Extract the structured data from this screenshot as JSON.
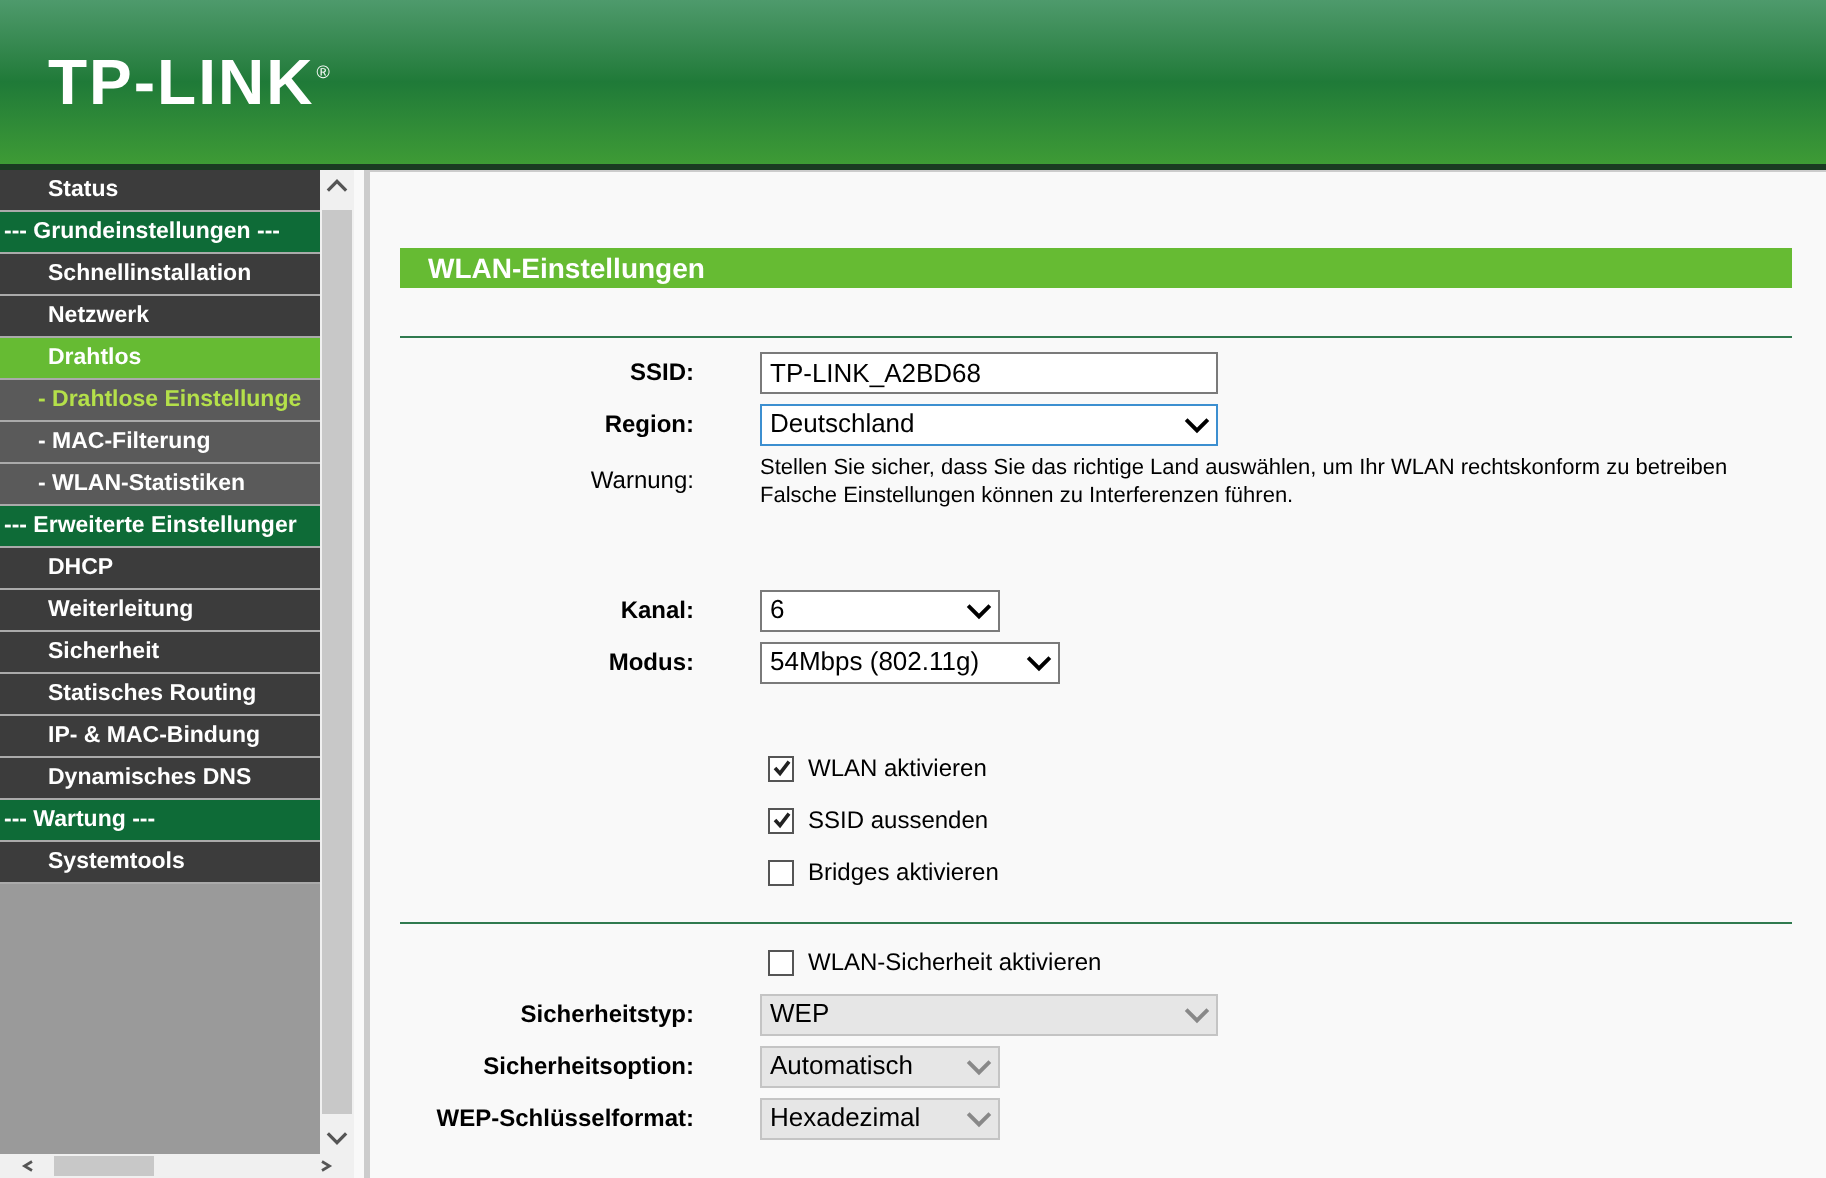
{
  "header": {
    "logo": "TP-LINK",
    "logo_mark": "®"
  },
  "menu": [
    {
      "kind": "item",
      "label": "Status",
      "selected": false
    },
    {
      "kind": "header",
      "label": "--- Grundeinstellungen ---"
    },
    {
      "kind": "item",
      "label": "Schnellinstallation",
      "selected": false
    },
    {
      "kind": "item",
      "label": "Netzwerk",
      "selected": false
    },
    {
      "kind": "item",
      "label": "Drahtlos",
      "selected": true
    },
    {
      "kind": "sub",
      "label": "- Drahtlose Einstellunge",
      "selected": true
    },
    {
      "kind": "sub",
      "label": "- MAC-Filterung",
      "selected": false
    },
    {
      "kind": "sub",
      "label": "- WLAN-Statistiken",
      "selected": false
    },
    {
      "kind": "header",
      "label": "--- Erweiterte Einstellunger"
    },
    {
      "kind": "item",
      "label": "DHCP",
      "selected": false
    },
    {
      "kind": "item",
      "label": "Weiterleitung",
      "selected": false
    },
    {
      "kind": "item",
      "label": "Sicherheit",
      "selected": false
    },
    {
      "kind": "item",
      "label": "Statisches Routing",
      "selected": false
    },
    {
      "kind": "item",
      "label": "IP- & MAC-Bindung",
      "selected": false
    },
    {
      "kind": "item",
      "label": "Dynamisches DNS",
      "selected": false
    },
    {
      "kind": "header",
      "label": "--- Wartung ---"
    },
    {
      "kind": "item",
      "label": "Systemtools",
      "selected": false
    }
  ],
  "page": {
    "title": "WLAN-Einstellungen",
    "section1": [
      {
        "kind": "text",
        "label": "SSID:",
        "value": "TP-LINK_A2BD68"
      },
      {
        "kind": "select",
        "label": "Region:",
        "value": "Deutschland",
        "focused": true,
        "disabled": false
      },
      {
        "kind": "note",
        "label": "Warnung:",
        "lines": [
          "Stellen Sie sicher, dass Sie das richtige Land auswählen, um Ihr WLAN rechtskonform zu betreiben",
          "Falsche Einstellungen können zu Interferenzen führen."
        ]
      },
      {
        "kind": "gap"
      },
      {
        "kind": "select",
        "label": "Kanal:",
        "value": "6",
        "focused": false,
        "disabled": false
      },
      {
        "kind": "select",
        "label": "Modus:",
        "value": "54Mbps (802.11g)",
        "focused": false,
        "disabled": false
      },
      {
        "kind": "gap"
      },
      {
        "kind": "checkbox",
        "label": "WLAN aktivieren",
        "checked": true
      },
      {
        "kind": "checkbox",
        "label": "SSID aussenden",
        "checked": true
      },
      {
        "kind": "checkbox",
        "label": "Bridges aktivieren",
        "checked": false
      }
    ],
    "section2": [
      {
        "kind": "checkbox",
        "label": "WLAN-Sicherheit aktivieren",
        "checked": false
      },
      {
        "kind": "select",
        "label": "Sicherheitstyp:",
        "value": "WEP",
        "focused": false,
        "disabled": true
      },
      {
        "kind": "select",
        "label": "Sicherheitsoption:",
        "value": "Automatisch",
        "focused": false,
        "disabled": true
      },
      {
        "kind": "select",
        "label": "WEP-Schlüsselformat:",
        "value": "Hexadezimal",
        "focused": false,
        "disabled": true
      }
    ]
  }
}
